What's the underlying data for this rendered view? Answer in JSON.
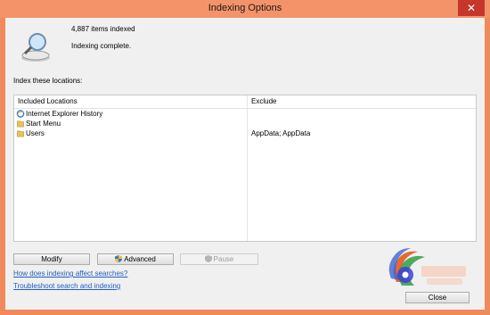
{
  "window": {
    "title": "Indexing Options",
    "close_glyph": "✕"
  },
  "summary": {
    "items_indexed": "4,887 items indexed",
    "status": "Indexing complete."
  },
  "locations": {
    "section_label": "Index these locations:",
    "headers": {
      "included": "Included Locations",
      "exclude": "Exclude"
    },
    "rows": [
      {
        "name": "Internet Explorer History",
        "exclude": "",
        "icon": "internet-explorer-icon"
      },
      {
        "name": "Start Menu",
        "exclude": "",
        "icon": "folder-icon"
      },
      {
        "name": "Users",
        "exclude": "AppData; AppData",
        "icon": "folder-icon"
      }
    ]
  },
  "buttons": {
    "modify": "Modify",
    "advanced": "Advanced",
    "pause": "Pause",
    "close": "Close"
  },
  "links": {
    "how_affects": "How does indexing affect searches?",
    "troubleshoot": "Troubleshoot search and indexing"
  },
  "colors": {
    "frame": "#f08a5c",
    "link": "#1f5fbf",
    "close_red": "#c7362b"
  }
}
